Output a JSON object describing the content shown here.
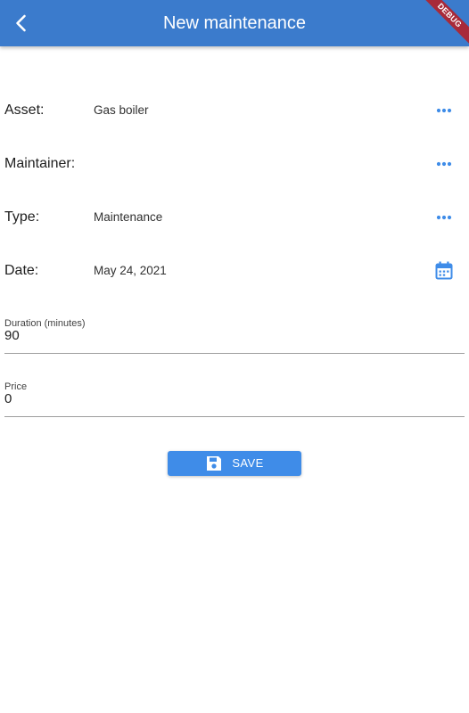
{
  "app_bar": {
    "title": "New maintenance",
    "back_icon": "chevron-left-icon",
    "background_color": "#3b7bcc",
    "debug_badge": "DEBUG"
  },
  "form": {
    "rows": [
      {
        "label": "Asset:",
        "value": "Gas boiler",
        "action_icon": "more-horiz-icon"
      },
      {
        "label": "Maintainer:",
        "value": "",
        "action_icon": "more-horiz-icon"
      },
      {
        "label": "Type:",
        "value": "Maintenance",
        "action_icon": "more-horiz-icon"
      },
      {
        "label": "Date:",
        "value": "May 24, 2021",
        "action_icon": "calendar-icon"
      }
    ],
    "duration": {
      "label": "Duration (minutes)",
      "value": "90"
    },
    "price": {
      "label": "Price",
      "value": "0"
    }
  },
  "save_button": {
    "label": "SAVE",
    "icon": "save-icon",
    "color": "#3f8ce8"
  },
  "accent_color": "#3f8ce8"
}
